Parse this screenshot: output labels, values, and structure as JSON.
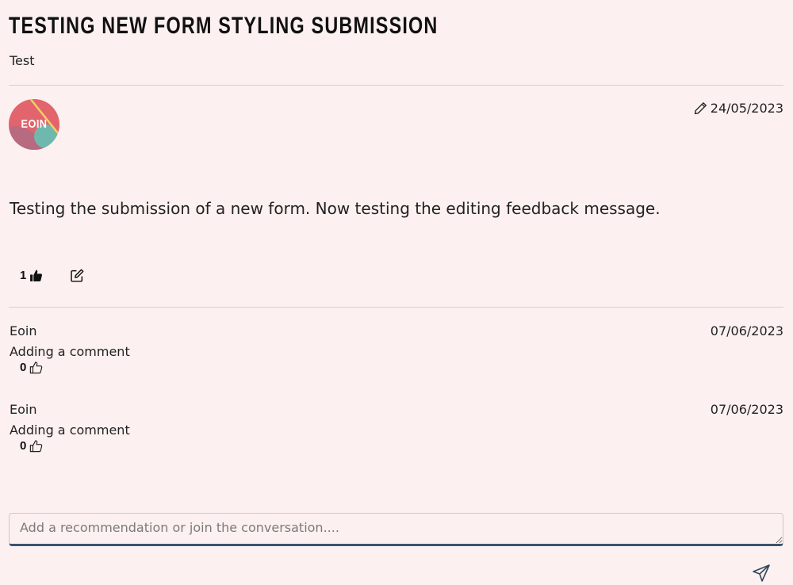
{
  "post": {
    "title": "TESTING NEW FORM STYLING SUBMISSION",
    "subtitle": "Test",
    "author_initials": "EOIN",
    "date": "24/05/2023",
    "body": "Testing the submission of a new form. Now testing the editing feedback message.",
    "likes": "1"
  },
  "comments": [
    {
      "author": "Eoin",
      "date": "07/06/2023",
      "text": "Adding a comment",
      "likes": "0"
    },
    {
      "author": "Eoin",
      "date": "07/06/2023",
      "text": "Adding a comment",
      "likes": "0"
    }
  ],
  "comment_form": {
    "placeholder": "Add a recommendation or join the conversation...."
  },
  "icons": {
    "date": "pencil-icon",
    "post_like": "thumbs-up-filled-icon",
    "edit": "edit-square-icon",
    "comment_like": "thumbs-up-outline-icon",
    "send": "send-icon"
  },
  "colors": {
    "background": "#fcf1f0",
    "divider": "#d6cfce",
    "input_accent": "#3b5470",
    "avatar_red": "#e2646c",
    "avatar_teal": "#6fb8ad",
    "avatar_yellow": "#f2cf63"
  }
}
